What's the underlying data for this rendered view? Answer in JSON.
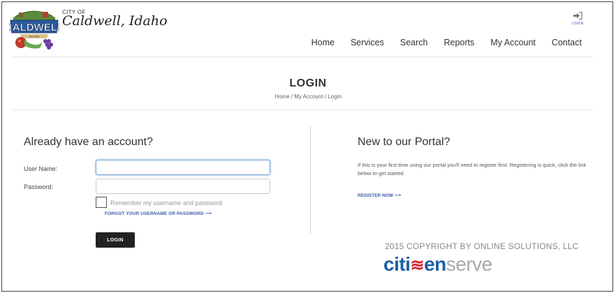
{
  "header": {
    "city_of": "CITY OF",
    "city_name": "Caldwell, Idaho",
    "logo_text": "CALDWELL",
    "logo_subtext": "IDAHO",
    "login_label": "LOGIN",
    "nav": [
      "Home",
      "Services",
      "Search",
      "Reports",
      "My Account",
      "Contact"
    ]
  },
  "page": {
    "title": "LOGIN",
    "breadcrumb": "Home / My Account / Login"
  },
  "login_form": {
    "heading": "Already have an account?",
    "username_label": "User Name:",
    "username_value": "",
    "password_label": "Password:",
    "password_value": "",
    "remember_label": "Remember my username and password",
    "forgot_link": "FORGOT YOUR USERNAME OR PASSWORD ⟶",
    "login_button": "LOGIN"
  },
  "register": {
    "heading": "New to our Portal?",
    "text": "If this is your first time using our portal you'll need to register first. Registering is quick, click the link below to get started.",
    "link": "REGISTER NOW ⟶"
  },
  "footer": {
    "copyright": "2015 COPYRIGHT BY ONLINE SOLUTIONS, LLC",
    "brand_part1": "citi",
    "brand_part2": "≋",
    "brand_part3": "en",
    "brand_part4": "serve"
  },
  "colors": {
    "accent": "#3a5ba8",
    "button": "#222222",
    "brand_blue": "#1f5ea8",
    "brand_red": "#d1262b"
  },
  "icons": {
    "login": "sign-in-icon",
    "logo": "caldwell-seal"
  }
}
